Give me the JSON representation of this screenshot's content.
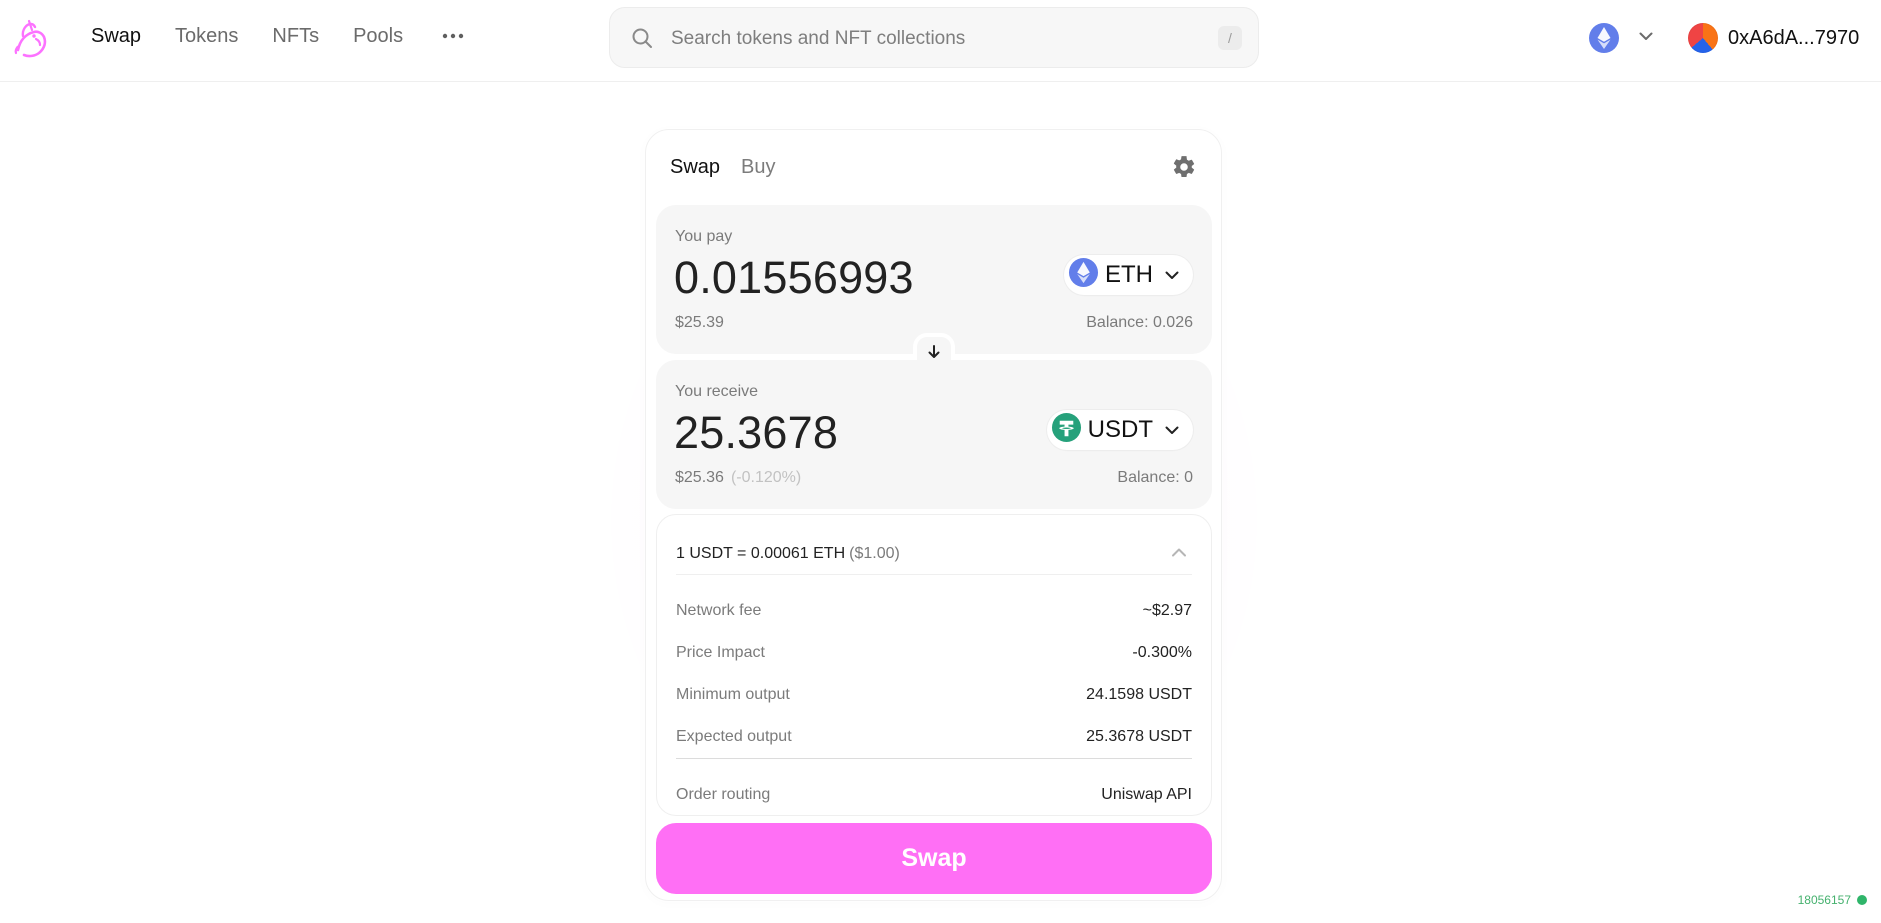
{
  "nav": {
    "links": [
      "Swap",
      "Tokens",
      "NFTs",
      "Pools"
    ],
    "active_link": "Swap",
    "more_icon": "more-dots-icon"
  },
  "search": {
    "placeholder": "Search tokens and NFT collections",
    "shortcut": "/"
  },
  "network": {
    "icon": "ethereum-icon",
    "chevron_icon": "chevron-down-icon"
  },
  "wallet": {
    "address": "0xA6dA...7970",
    "avatar_icon": "wallet-avatar-icon"
  },
  "swap": {
    "tabs": [
      "Swap",
      "Buy"
    ],
    "active_tab": "Swap",
    "settings_icon": "gear-icon",
    "pay": {
      "label": "You pay",
      "amount": "0.01556993",
      "token": "ETH",
      "usd_value": "$25.39",
      "balance": "Balance: 0.026",
      "token_icon": "ethereum-icon"
    },
    "receive": {
      "label": "You receive",
      "amount": "25.3678",
      "token": "USDT",
      "usd_value": "$25.36",
      "usd_change": "(-0.120%)",
      "balance": "Balance: 0",
      "token_icon": "tether-icon"
    },
    "switch_icon": "arrow-down-icon",
    "rate": {
      "text": "1 USDT = 0.00061 ETH",
      "usd": "($1.00)",
      "collapse_icon": "chevron-up-icon"
    },
    "details": [
      {
        "label": "Network fee",
        "value": "~$2.97"
      },
      {
        "label": "Price Impact",
        "value": "-0.300%"
      },
      {
        "label": "Minimum output",
        "value": "24.1598 USDT"
      },
      {
        "label": "Expected output",
        "value": "25.3678 USDT"
      },
      {
        "label": "Order routing",
        "value": "Uniswap API"
      }
    ],
    "button_label": "Swap"
  },
  "status": {
    "block": "18056157"
  },
  "colors": {
    "accent": "#ff6ff5",
    "accent_logo": "#fc72ff",
    "status_green": "#2fb56a",
    "eth_blue": "#627eea",
    "tether_green": "#26a17b"
  }
}
